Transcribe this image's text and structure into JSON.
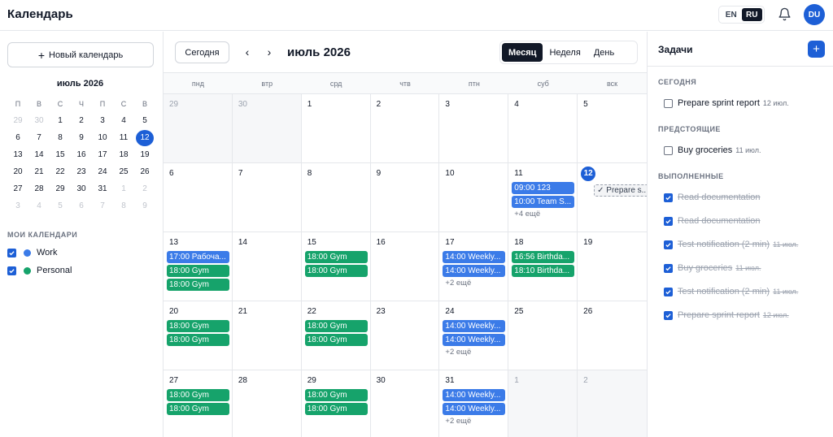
{
  "header": {
    "title": "Календарь",
    "lang_en": "EN",
    "lang_ru": "RU",
    "avatar": "DU",
    "icons": {
      "bell": "bell-icon"
    }
  },
  "sidebar": {
    "new_calendar": "Новый календарь",
    "mini_month": "июль 2026",
    "weekdays": [
      "П",
      "В",
      "С",
      "Ч",
      "П",
      "С",
      "В"
    ],
    "weeks": [
      [
        "29",
        "30",
        "1",
        "2",
        "3",
        "4",
        "5"
      ],
      [
        "6",
        "7",
        "8",
        "9",
        "10",
        "11",
        "12"
      ],
      [
        "13",
        "14",
        "15",
        "16",
        "17",
        "18",
        "19"
      ],
      [
        "20",
        "21",
        "22",
        "23",
        "24",
        "25",
        "26"
      ],
      [
        "27",
        "28",
        "29",
        "30",
        "31",
        "1",
        "2"
      ],
      [
        "3",
        "4",
        "5",
        "6",
        "7",
        "8",
        "9"
      ]
    ],
    "my_calendars_label": "МОИ КАЛЕНДАРИ",
    "calendars": [
      {
        "name": "Work",
        "color": "#3b7be8",
        "checked": true
      },
      {
        "name": "Personal",
        "color": "#16a36b",
        "checked": true
      }
    ]
  },
  "toolbar": {
    "today": "Сегодня",
    "month_title": "июль 2026",
    "views": [
      "Месяц",
      "Неделя",
      "День"
    ],
    "active_view": "Месяц"
  },
  "calendar": {
    "weekdays": [
      "пнд",
      "втр",
      "срд",
      "чтв",
      "птн",
      "суб",
      "вск"
    ],
    "weeks": [
      [
        {
          "day": "29",
          "out": true
        },
        {
          "day": "30",
          "out": true
        },
        {
          "day": "1"
        },
        {
          "day": "2"
        },
        {
          "day": "3"
        },
        {
          "day": "4"
        },
        {
          "day": "5"
        }
      ],
      [
        {
          "day": "6"
        },
        {
          "day": "7"
        },
        {
          "day": "8"
        },
        {
          "day": "9"
        },
        {
          "day": "10"
        },
        {
          "day": "11",
          "events": [
            {
              "text": "09:00 123",
              "color": "blue"
            },
            {
              "text": "10:00 Team S...",
              "color": "blue"
            }
          ],
          "more": "+4 ещё"
        },
        {
          "day": "12",
          "today": true,
          "events": [
            {
              "text": "✓ Prepare s...",
              "color": "task"
            }
          ]
        }
      ],
      [
        {
          "day": "13",
          "events": [
            {
              "text": "17:00 Рабоча...",
              "color": "blue"
            },
            {
              "text": "18:00 Gym",
              "color": "green"
            },
            {
              "text": "18:00 Gym",
              "color": "green"
            }
          ]
        },
        {
          "day": "14"
        },
        {
          "day": "15",
          "events": [
            {
              "text": "18:00 Gym",
              "color": "green"
            },
            {
              "text": "18:00 Gym",
              "color": "green"
            }
          ]
        },
        {
          "day": "16"
        },
        {
          "day": "17",
          "events": [
            {
              "text": "14:00 Weekly...",
              "color": "blue"
            },
            {
              "text": "14:00 Weekly...",
              "color": "blue"
            }
          ],
          "more": "+2 ещё"
        },
        {
          "day": "18",
          "events": [
            {
              "text": "16:56 Birthda...",
              "color": "green"
            },
            {
              "text": "18:10 Birthda...",
              "color": "green"
            }
          ]
        },
        {
          "day": "19"
        }
      ],
      [
        {
          "day": "20",
          "events": [
            {
              "text": "18:00 Gym",
              "color": "green"
            },
            {
              "text": "18:00 Gym",
              "color": "green"
            }
          ]
        },
        {
          "day": "21"
        },
        {
          "day": "22",
          "events": [
            {
              "text": "18:00 Gym",
              "color": "green"
            },
            {
              "text": "18:00 Gym",
              "color": "green"
            }
          ]
        },
        {
          "day": "23"
        },
        {
          "day": "24",
          "events": [
            {
              "text": "14:00 Weekly...",
              "color": "blue"
            },
            {
              "text": "14:00 Weekly...",
              "color": "blue"
            }
          ],
          "more": "+2 ещё"
        },
        {
          "day": "25"
        },
        {
          "day": "26"
        }
      ],
      [
        {
          "day": "27",
          "events": [
            {
              "text": "18:00 Gym",
              "color": "green"
            },
            {
              "text": "18:00 Gym",
              "color": "green"
            }
          ]
        },
        {
          "day": "28"
        },
        {
          "day": "29",
          "events": [
            {
              "text": "18:00 Gym",
              "color": "green"
            },
            {
              "text": "18:00 Gym",
              "color": "green"
            }
          ]
        },
        {
          "day": "30"
        },
        {
          "day": "31",
          "events": [
            {
              "text": "14:00 Weekly...",
              "color": "blue"
            },
            {
              "text": "14:00 Weekly...",
              "color": "blue"
            }
          ],
          "more": "+2 ещё"
        },
        {
          "day": "1",
          "out": true
        },
        {
          "day": "2",
          "out": true
        }
      ]
    ]
  },
  "tasks": {
    "title": "Задачи",
    "sections": [
      {
        "label": "СЕГОДНЯ",
        "items": [
          {
            "title": "Prepare sprint report",
            "date": "12 июл.",
            "done": false
          }
        ]
      },
      {
        "label": "ПРЕДСТОЯЩИЕ",
        "items": [
          {
            "title": "Buy groceries",
            "date": "11 июл.",
            "done": false
          }
        ]
      },
      {
        "label": "ВЫПОЛНЕННЫЕ",
        "items": [
          {
            "title": "Read documentation",
            "date": "",
            "done": true
          },
          {
            "title": "Read documentation",
            "date": "",
            "done": true
          },
          {
            "title": "Test notification (2 min)",
            "date": "11 июл.",
            "done": true
          },
          {
            "title": "Buy groceries",
            "date": "11 июл.",
            "done": true
          },
          {
            "title": "Test notification (2 min)",
            "date": "11 июл.",
            "done": true
          },
          {
            "title": "Prepare sprint report",
            "date": "12 июл.",
            "done": true
          }
        ]
      }
    ]
  },
  "colors": {
    "accent": "#1d5fd6",
    "work": "#3b7be8",
    "personal": "#16a36b"
  }
}
